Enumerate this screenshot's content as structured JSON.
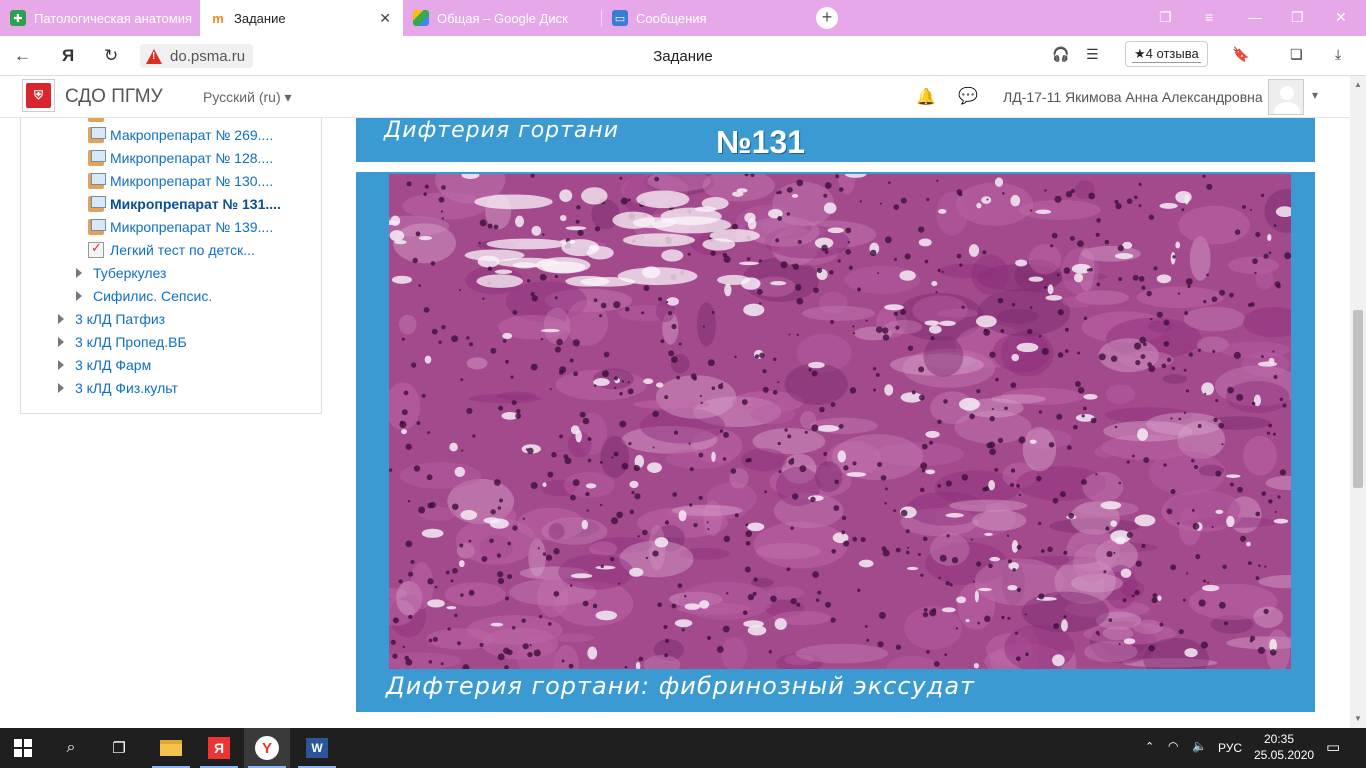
{
  "tabs": [
    {
      "label": "Патологическая анатомия",
      "active": false
    },
    {
      "label": "Задание",
      "active": true
    },
    {
      "label": "Общая – Google Диск",
      "active": false
    },
    {
      "label": "Сообщения",
      "active": false
    }
  ],
  "address": {
    "url": "do.psma.ru",
    "page_title": "Задание",
    "reviews": "★4 отзыва"
  },
  "header": {
    "site_name": "СДО ПГМУ",
    "language": "Русский (ru)",
    "user_name": "ЛД-17-11 Якимова Анна Александровна"
  },
  "sidebar": {
    "items": [
      {
        "label": "Макропрепарат № 269....",
        "type": "resource",
        "level": 3
      },
      {
        "label": "Микропрепарат № 128....",
        "type": "resource",
        "level": 3
      },
      {
        "label": "Микропрепарат № 130....",
        "type": "resource",
        "level": 3
      },
      {
        "label": "Микропрепарат № 131....",
        "type": "resource",
        "level": 3,
        "current": true
      },
      {
        "label": "Микропрепарат № 139....",
        "type": "resource",
        "level": 3
      },
      {
        "label": "Легкий тест по детск...",
        "type": "quiz",
        "level": 3
      },
      {
        "label": "Туберкулез",
        "type": "folder",
        "level": 2
      },
      {
        "label": "Сифилис. Сепсис.",
        "type": "folder",
        "level": 2
      },
      {
        "label": "3 кЛД Патфиз",
        "type": "folder",
        "level": 1
      },
      {
        "label": "3 кЛД Пропед.ВБ",
        "type": "folder",
        "level": 1
      },
      {
        "label": "3 кЛД Фарм",
        "type": "folder",
        "level": 1
      },
      {
        "label": "3 кЛД Физ.культ",
        "type": "folder",
        "level": 1
      }
    ]
  },
  "slide": {
    "title": "Дифтерия гортани",
    "number": "№131",
    "caption": "Дифтерия гортани: фибринозный экссудат"
  },
  "taskbar": {
    "lang": "РУС",
    "time": "20:35",
    "date": "25.05.2020"
  },
  "colors": {
    "tab_strip": "#e6a8e8",
    "slide_blue": "#3b9ad2",
    "link": "#0f6fc5",
    "tissue": "#9a3a85"
  }
}
